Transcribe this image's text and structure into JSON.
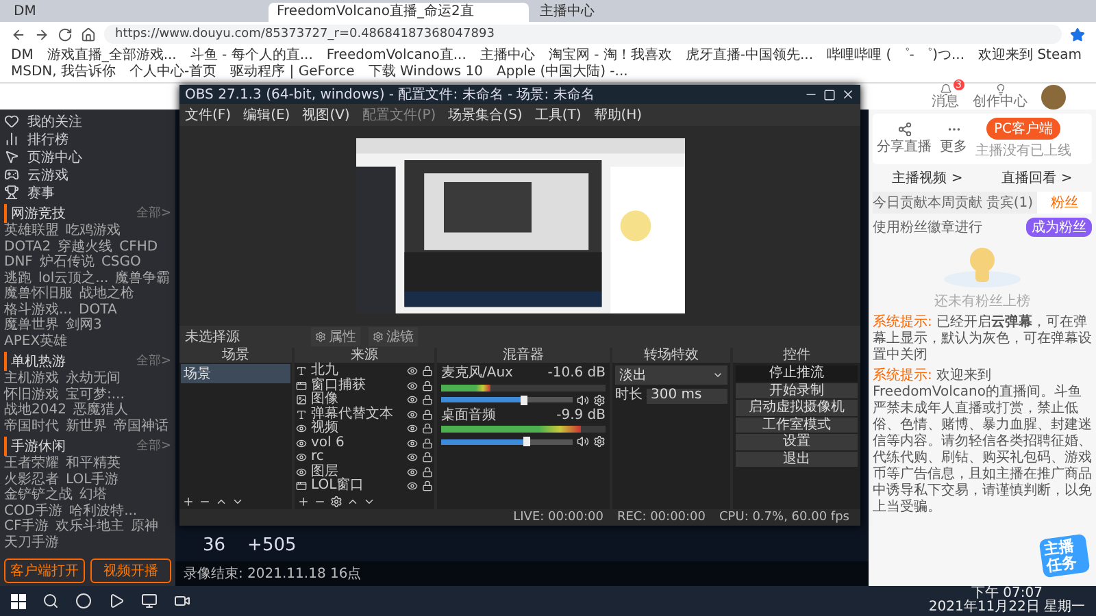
{
  "browser": {
    "tabs": [
      {
        "title": "DM",
        "selected": false
      },
      {
        "title": "FreedomVolcano直播_命运2直",
        "selected": true
      },
      {
        "title": "主播中心",
        "selected": false
      }
    ],
    "address": "https://www.douyu.com/85373727_r=0.48684187368047893",
    "bookmarks": [
      "DM",
      "游戏直播_全部游戏...",
      "斗鱼 - 每个人的直...",
      "FreedomVolcano直...",
      "主播中心",
      "淘宝网 - 淘！我喜欢",
      "虎牙直播-中国领先...",
      "哔哩哔哩 ( ゜- ゜)つ...",
      "欢迎来到 Steam",
      "MSDN, 我告诉你",
      "个人中心-首页",
      "驱动程序 | GeForce",
      "下载 Windows 10",
      "Apple (中国大陆) -..."
    ]
  },
  "header": {
    "message_badge": "3",
    "items": [
      {
        "label": "消息"
      },
      {
        "label": "创作中心"
      }
    ]
  },
  "sidebar": {
    "nav": [
      {
        "label": "我的关注",
        "kind": "heart"
      },
      {
        "label": "排行榜",
        "kind": "rank"
      },
      {
        "label": "页游中心",
        "kind": "mouse"
      },
      {
        "label": "云游戏",
        "kind": "gamepad"
      },
      {
        "label": "赛事",
        "kind": "trophy"
      }
    ],
    "sections": [
      {
        "title": "网游竞技",
        "more": "全部>",
        "items": [
          "英雄联盟",
          "吃鸡游戏",
          "DOTA2",
          "穿越火线",
          "CFHD",
          "DNF",
          "炉石传说",
          "CSGO",
          "逃跑",
          "lol云顶之...",
          "魔兽争霸",
          "魔兽怀旧服",
          "战地之枪",
          "格斗游戏...",
          "DOTA",
          "魔兽世界",
          "剑网3",
          "APEX英雄"
        ]
      },
      {
        "title": "单机热游",
        "more": "全部>",
        "items": [
          "主机游戏",
          "永劫无间",
          "怀旧游戏",
          "宝可梦:...",
          "战地2042",
          "恶魔猎人",
          "帝国时代",
          "新世界",
          "帝国神话"
        ]
      },
      {
        "title": "手游休闲",
        "more": "全部>",
        "items": [
          "王者荣耀",
          "和平精英",
          "火影忍者",
          "LOL手游",
          "金铲铲之战",
          "幻塔",
          "COD手游",
          "哈利波特...",
          "CF手游",
          "欢乐斗地主",
          "原神",
          "天刀手游"
        ]
      }
    ],
    "buttons": [
      {
        "label": "客户端打开"
      },
      {
        "label": "视频开播"
      }
    ]
  },
  "video": {
    "ammo": "36",
    "score": "+505",
    "caption": "录像结束: 2021.11.18 16点"
  },
  "obs": {
    "title": "OBS 27.1.3 (64-bit, windows) - 配置文件: 未命名 - 场景: 未命名",
    "menu": [
      "文件(F)",
      "编辑(E)",
      "视图(V)",
      "配置文件(P)",
      "场景集合(S)",
      "工具(T)",
      "帮助(H)"
    ],
    "source_toolbar": {
      "label": "未选择源",
      "buttons": [
        "属性",
        "滤镜"
      ]
    },
    "docks": [
      "场景",
      "来源",
      "混音器",
      "转场特效",
      "控件"
    ],
    "scenes": [
      {
        "name": "场景",
        "selected": true
      }
    ],
    "sources": [
      {
        "name": "北九",
        "kind": "text"
      },
      {
        "name": "窗口捕获",
        "kind": "window"
      },
      {
        "name": "图像",
        "kind": "image"
      },
      {
        "name": "弹幕代替文本",
        "kind": "text"
      },
      {
        "name": "视频",
        "kind": "media"
      },
      {
        "name": "vol 6",
        "kind": "media"
      },
      {
        "name": "rc",
        "kind": "media"
      },
      {
        "name": "图层",
        "kind": "media"
      },
      {
        "name": "LOL窗口",
        "kind": "window"
      }
    ],
    "mixer": [
      {
        "name": "麦克风/Aux",
        "reading": "-10.6 dB",
        "meter": {
          "level": 0.3
        },
        "volume": {
          "level": 0.6
        }
      },
      {
        "name": "桌面音频",
        "reading": "-9.9 dB",
        "meter": {
          "level": 0.85
        },
        "volume": {
          "level": 0.62
        }
      }
    ],
    "transition": {
      "value": "淡出",
      "duration_label": "时长",
      "duration": "300 ms"
    },
    "controls": [
      {
        "label": "停止推流",
        "selected": true
      },
      {
        "label": "开始录制",
        "selected": false
      },
      {
        "label": "启动虚拟摄像机",
        "selected": false
      },
      {
        "label": "工作室模式",
        "selected": false
      },
      {
        "label": "设置",
        "selected": false
      },
      {
        "label": "退出",
        "selected": false
      }
    ],
    "status": {
      "live": "LIVE: 00:00:00",
      "rec": "REC: 00:00:00",
      "cpu": "CPU: 0.7%, 60.00 fps"
    }
  },
  "panel": {
    "actions": [
      {
        "label": "分享直播"
      },
      {
        "label": "更多"
      }
    ],
    "client_button": "PC客户端",
    "client_note": "主播没有已上线",
    "links": [
      "主播视频 >",
      "直播回看 >"
    ],
    "tabs": [
      {
        "label": "今日贡献",
        "selected": false
      },
      {
        "label": "本周贡献",
        "selected": false
      },
      {
        "label": "贵宾(1)",
        "selected": false
      },
      {
        "label": "粉丝",
        "selected": true
      }
    ],
    "fan_hint": "使用粉丝徽章进行",
    "fan_button": "成为粉丝",
    "empty": "还未有粉丝上榜",
    "badge": "主播任务",
    "messages": [
      {
        "tag": "系统提示:",
        "text": "已经开启**云弹幕**，可在弹幕上显示，默认为灰色，可在弹幕设置中关闭"
      },
      {
        "tag": "系统提示:",
        "text": "欢迎来到FreedomVolcano的直播间。斗鱼严禁未成年人直播或打赏，禁止低俗、色情、赌博、暴力血腥、封建迷信等内容。请勿轻信各类招聘征婚、代练代购、刷钻、购买礼包码、游戏币等广告信息，且如主播在推广商品中诱导私下交易，请谨慎判断，以免上当受骗。"
      }
    ]
  },
  "taskbar": {
    "time": "下午 07:07",
    "date": "2021年11月22日 星期一"
  }
}
